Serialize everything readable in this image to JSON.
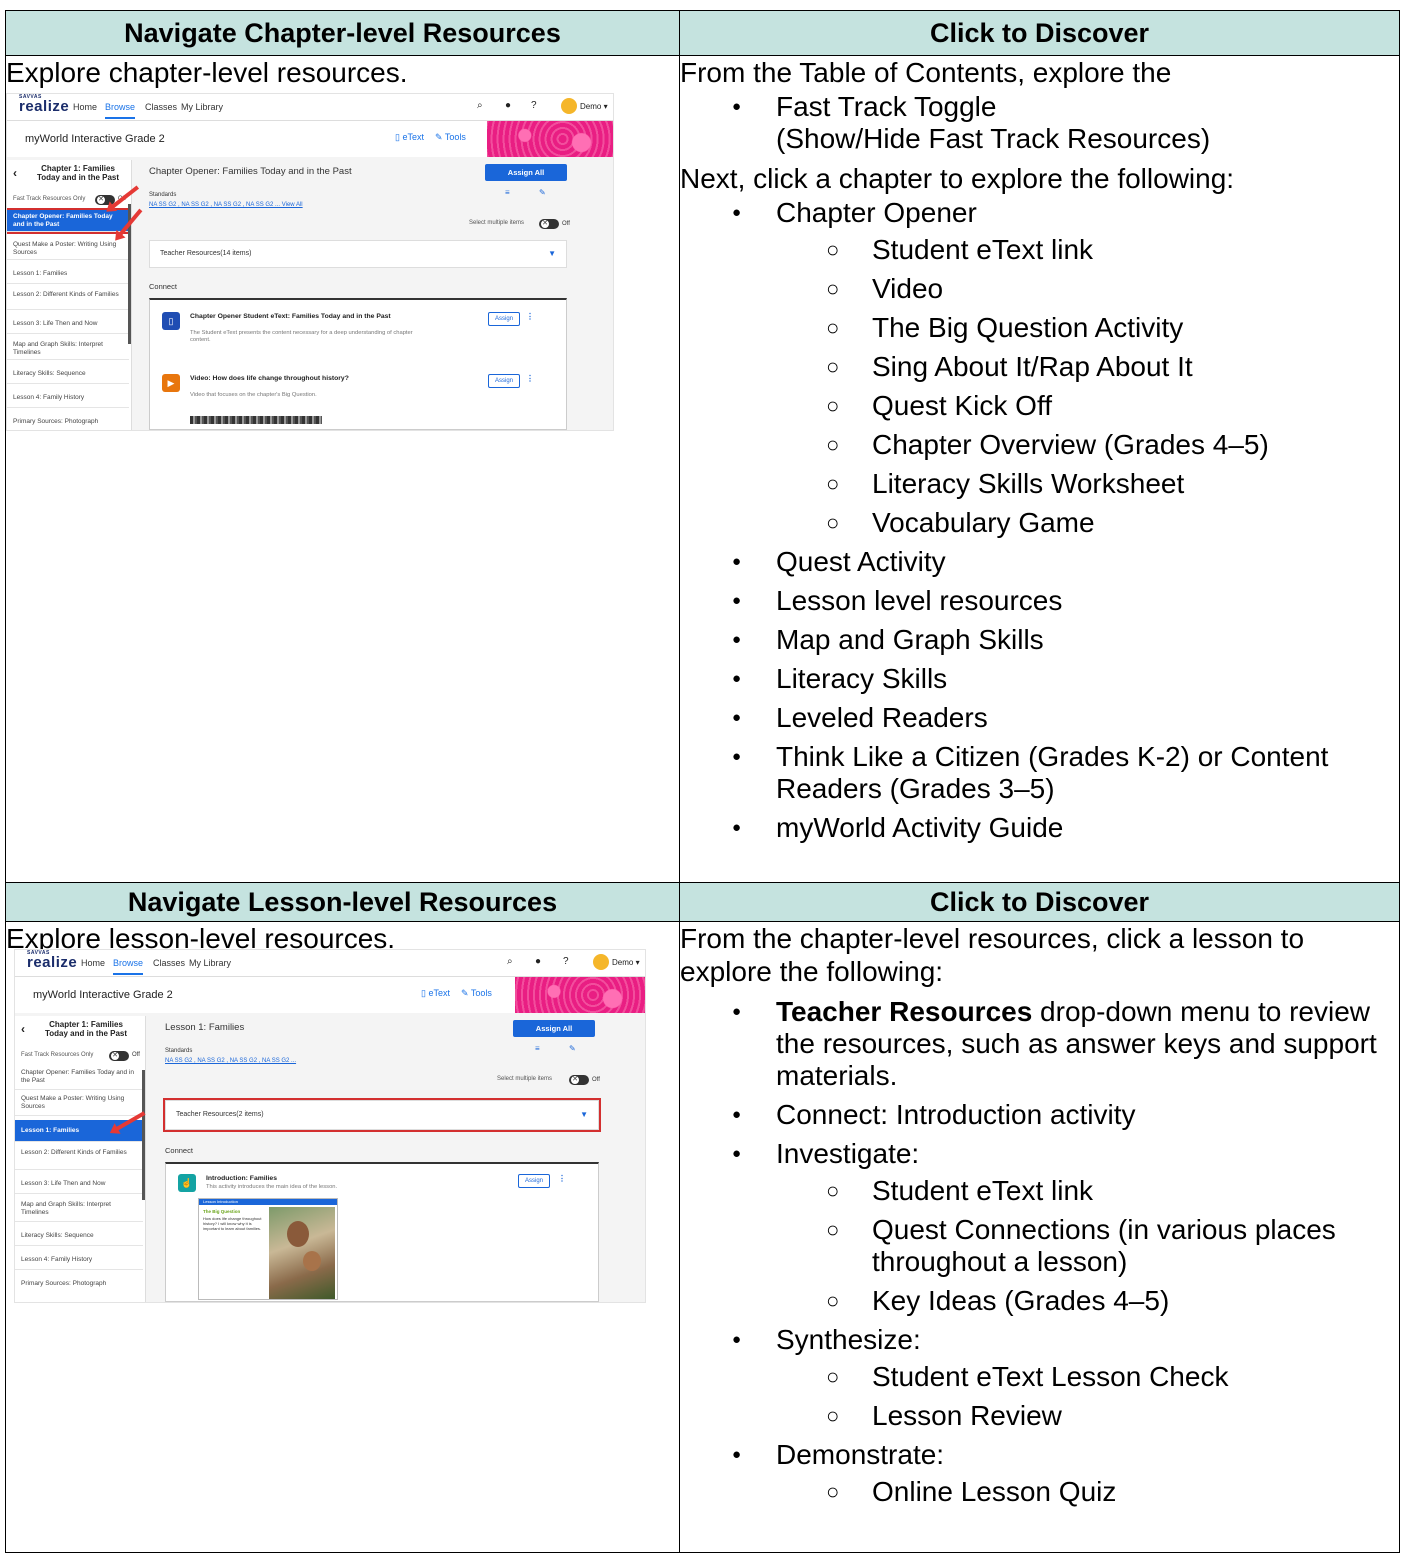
{
  "section1": {
    "left_header": "Navigate Chapter-level Resources",
    "right_header": "Click to Discover",
    "intro": "Explore chapter-level resources.",
    "screenshot": {
      "logo_small": "SAVVAS",
      "logo": "realize",
      "nav": [
        "Home",
        "Browse",
        "Classes",
        "My Library"
      ],
      "user": "Demo ▾",
      "program_title": "myWorld Interactive Grade 2",
      "etext": "eText",
      "tools": "Tools",
      "sidebar_header": "Chapter 1: Families Today and in the Past",
      "fast_track_label": "Fast Track Resources Only",
      "toggle_state": "Off",
      "sidebar_items": [
        "Chapter Opener: Families Today and in the Past",
        "Quest Make a Poster: Writing Using Sources",
        "Lesson 1: Families",
        "Lesson 2: Different Kinds of Families",
        "Lesson 3: Life Then and Now",
        "Map and Graph Skills: Interpret Timelines",
        "Literacy Skills: Sequence",
        "Lesson 4: Family History",
        "Primary Sources: Photograph"
      ],
      "main_title": "Chapter Opener: Families Today and in the Past",
      "assign_all": "Assign All",
      "standards_label": "Standards",
      "standards_links": "NA SS G2 , NA SS G2 , NA SS G2 , NA SS G2 ... View All",
      "select_multiple": "Select multiple items",
      "teacher_resources": "Teacher Resources(14 items)",
      "connect": "Connect",
      "resources": [
        {
          "title": "Chapter Opener Student eText: Families Today and in the Past",
          "desc": "The Student eText presents the content necessary for a deep understanding of chapter content.",
          "assign": "Assign"
        },
        {
          "title": "Video: How does life change throughout history?",
          "desc": "Video that focuses on the chapter's Big Question.",
          "assign": "Assign"
        }
      ]
    },
    "right": {
      "p1": "From the Table of Contents, explore the",
      "toggle_item_line1": "Fast  Track Toggle",
      "toggle_item_line2": "(Show/Hide Fast Track Resources)",
      "p2": "Next, click a chapter to explore the following:",
      "chapter_opener": "Chapter Opener",
      "chapter_opener_sub": [
        "Student eText link",
        "Video",
        "The Big Question Activity",
        "Sing About It/Rap About It",
        "Quest Kick Off",
        "Chapter Overview (Grades 4–5)",
        "Literacy Skills Worksheet",
        "Vocabulary Game"
      ],
      "items": [
        "Quest Activity",
        "Lesson level resources",
        "Map and Graph Skills",
        "Literacy Skills",
        "Leveled Readers",
        "Think Like a Citizen (Grades K-2) or Content Readers (Grades 3–5)",
        "myWorld Activity Guide"
      ]
    }
  },
  "section2": {
    "left_header": "Navigate Lesson-level Resources",
    "right_header": "Click to Discover",
    "intro": "Explore lesson-level resources.",
    "screenshot": {
      "logo_small": "SAVVAS",
      "logo": "realize",
      "nav": [
        "Home",
        "Browse",
        "Classes",
        "My Library"
      ],
      "user": "Demo ▾",
      "program_title": "myWorld Interactive Grade 2",
      "etext": "eText",
      "tools": "Tools",
      "sidebar_header": "Chapter 1: Families Today and in the Past",
      "fast_track_label": "Fast Track Resources Only",
      "toggle_state": "Off",
      "sidebar_items": [
        "Chapter Opener: Families Today and in the Past",
        "Quest Make a Poster: Writing Using Sources",
        "Lesson 1: Families",
        "Lesson 2: Different Kinds of Families",
        "Lesson 3: Life Then and Now",
        "Map and Graph Skills: Interpret Timelines",
        "Literacy Skills: Sequence",
        "Lesson 4: Family History",
        "Primary Sources: Photograph"
      ],
      "main_title": "Lesson 1: Families",
      "assign_all": "Assign All",
      "standards_label": "Standards",
      "standards_links": "NA SS G2 , NA SS G2 , NA SS G2 , NA SS G2 ...",
      "select_multiple": "Select multiple items",
      "teacher_resources": "Teacher Resources(2 items)",
      "connect": "Connect",
      "resource": {
        "title": "Introduction: Families",
        "desc": "This activity introduces the main idea of the lesson.",
        "assign": "Assign"
      },
      "lesson_img": {
        "bar": "Lesson Introduction",
        "q": "The Big Question",
        "text": "How does life change throughout history? I will know why it is important to learn about families."
      }
    },
    "right": {
      "p1": "From the chapter-level resources, click a lesson to explore the following:",
      "tr_bold": "Teacher Resources",
      "tr_rest": " drop-down menu to review the resources, such as answer keys and support materials.",
      "connect_item": "Connect: Introduction activity",
      "investigate": "Investigate:",
      "investigate_sub": [
        "Student eText link",
        "Quest Connections (in various places throughout a lesson)",
        "Key Ideas (Grades 4–5)"
      ],
      "synthesize": "Synthesize:",
      "synthesize_sub": [
        "Student eText Lesson Check",
        "Lesson Review"
      ],
      "demonstrate": "Demonstrate:",
      "demonstrate_sub": [
        "Online Lesson Quiz"
      ]
    }
  }
}
